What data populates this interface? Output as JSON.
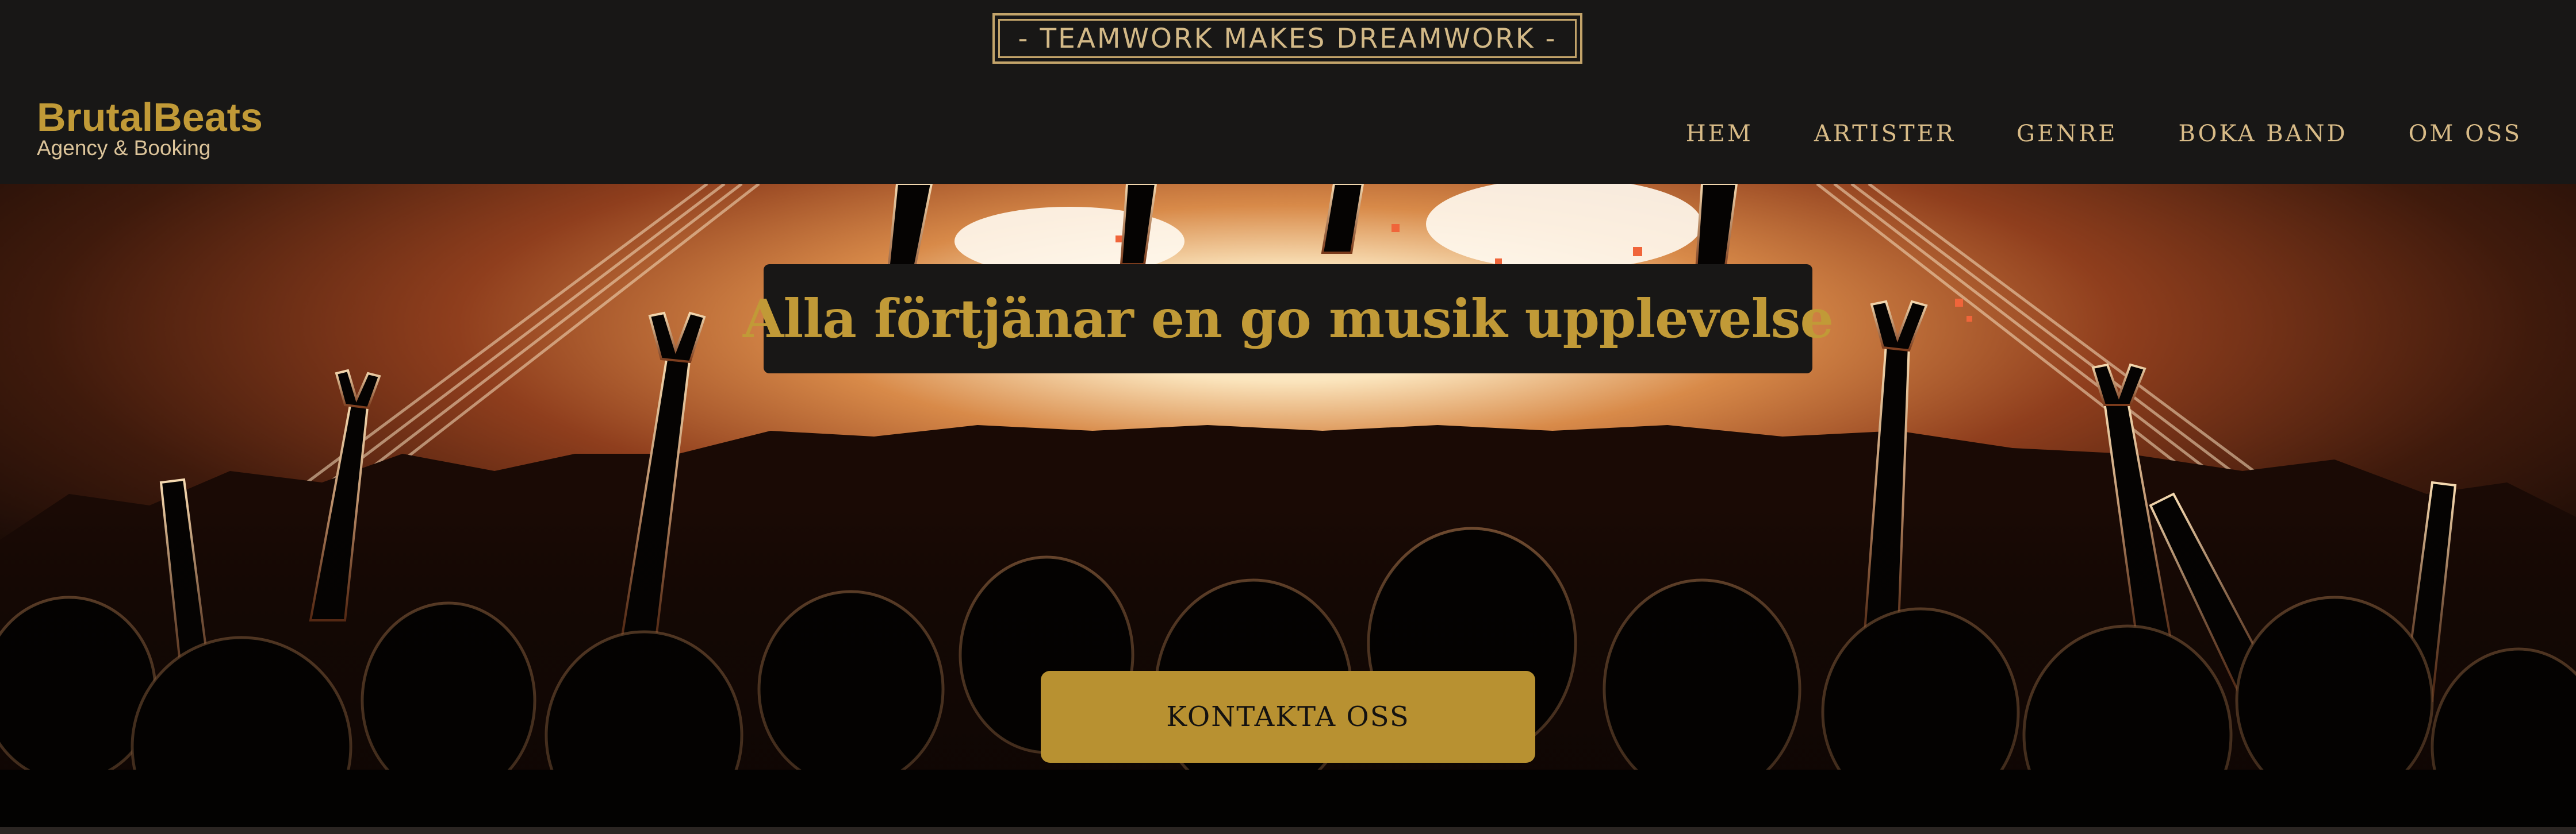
{
  "header": {
    "tagline": "- TEAMWORK MAKES DREAMWORK -",
    "brand": {
      "name": "BrutalBeats",
      "subtitle": "Agency & Booking"
    },
    "nav": [
      "HEM",
      "ARTISTER",
      "GENRE",
      "BOKA BAND",
      "OM OSS"
    ]
  },
  "hero": {
    "headline": "Alla förtjänar en go musik upplevelse",
    "cta_label": "KONTAKTA OSS",
    "image_subject": "concert-crowd-photo"
  },
  "colors": {
    "background": "#181716",
    "accent_gold": "#c19a37",
    "button_gold": "#b89131",
    "nav_text": "#d8bb87",
    "tagline_border": "#c3a46a"
  }
}
